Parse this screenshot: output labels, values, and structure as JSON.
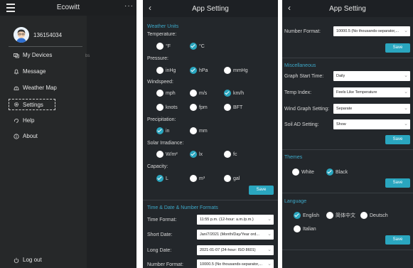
{
  "drawer": {
    "app_title": "Ecowitt",
    "more": "···",
    "username": "136154034",
    "behind_text": "bs",
    "items": [
      {
        "label": "My Devices",
        "icon": "devices-icon"
      },
      {
        "label": "Message",
        "icon": "bell-icon"
      },
      {
        "label": "Weather Map",
        "icon": "map-icon"
      },
      {
        "label": "Settings",
        "icon": "gear-icon"
      },
      {
        "label": "Help",
        "icon": "help-icon"
      },
      {
        "label": "About",
        "icon": "info-icon"
      }
    ],
    "logout": "Log out"
  },
  "settings1": {
    "title": "App Setting",
    "weather_units": "Weather Units",
    "temperature": {
      "label": "Temperature:",
      "options": [
        "°F",
        "°C"
      ],
      "selected": 1
    },
    "pressure": {
      "label": "Pressure:",
      "options": [
        "inHg",
        "hPa",
        "mmHg"
      ],
      "selected": 1
    },
    "windspeed": {
      "label": "Windspeed:",
      "options": [
        "mph",
        "m/s",
        "km/h",
        "knots",
        "fpm",
        "BFT"
      ],
      "selected": 2
    },
    "precipitation": {
      "label": "Precipitation:",
      "options": [
        "in",
        "mm"
      ],
      "selected": 0
    },
    "solar": {
      "label": "Solar Irradiance:",
      "options": [
        "W/m²",
        "lx",
        "fc"
      ],
      "selected": 1
    },
    "capacity": {
      "label": "Capacity:",
      "options": [
        "L",
        "m³",
        "gal"
      ],
      "selected": 0
    },
    "save": "Save",
    "time_section": "Time & Date & Number Formats",
    "time_format": {
      "label": "Time Format:",
      "value": "11:55 p.m. (12-hour: a.m./p.m.)"
    },
    "short_date": {
      "label": "Short Date:",
      "value": "Jan/7/2021 (Month/Day/Year ord..."
    },
    "long_date": {
      "label": "Long Date:",
      "value": "2021-01-07 (24-hour: ISO 8601)"
    },
    "number_format": {
      "label": "Number Format:",
      "value": "10000.5 (No thousands-separator,..."
    }
  },
  "settings2": {
    "title": "App Setting",
    "number_format": {
      "label": "Number Format:",
      "value": "10000.5 (No thousands-separator,..."
    },
    "save": "Save",
    "misc": "Miscellaneous",
    "graph_start": {
      "label": "Graph Start Time:",
      "value": "Daily"
    },
    "temp_index": {
      "label": "Temp Index:",
      "value": "Feels Like Temperature"
    },
    "wind_graph": {
      "label": "Wind Graph Setting:",
      "value": "Separate"
    },
    "soil_ad": {
      "label": "Soil AD Setting:",
      "value": "Show"
    },
    "themes": "Themes",
    "theme_options": [
      "White",
      "Black"
    ],
    "theme_selected": 1,
    "language": "Language",
    "lang_options": [
      "English",
      "简体中文",
      "Deutsch",
      "Italian"
    ],
    "lang_selected": 0
  },
  "colors": {
    "accent": "#2aa6bf",
    "panel": "#23272b",
    "drawer": "#262829"
  }
}
